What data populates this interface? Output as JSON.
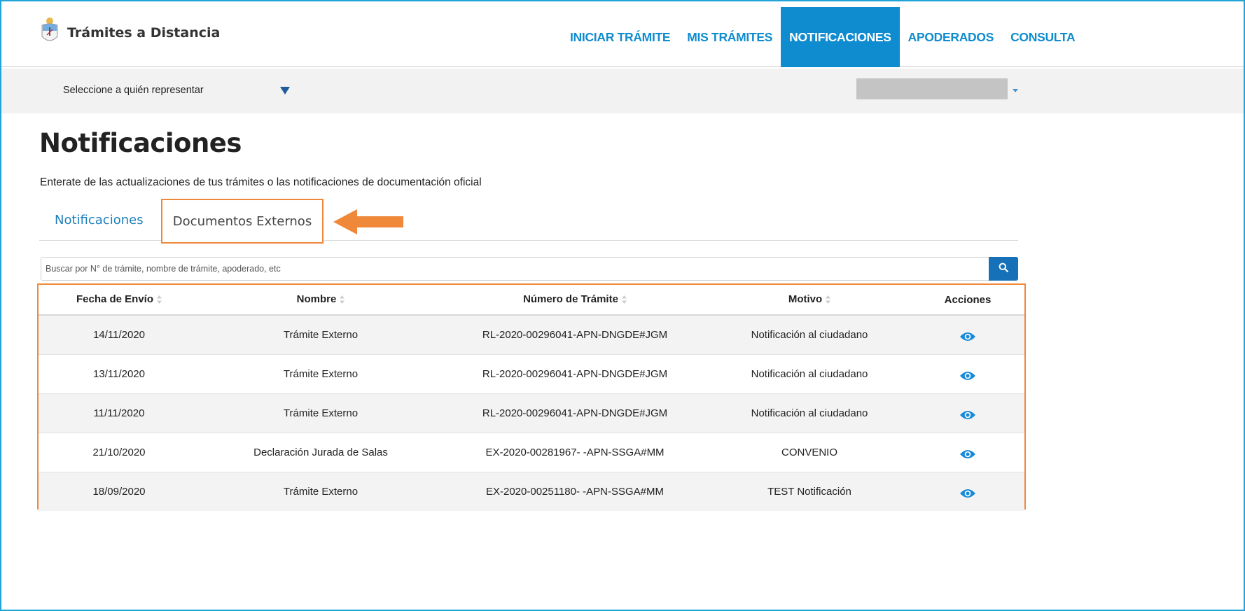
{
  "header": {
    "brand": "Trámites a Distancia",
    "nav": [
      {
        "label": "INICIAR TRÁMITE",
        "active": false
      },
      {
        "label": "MIS TRÁMITES",
        "active": false
      },
      {
        "label": "NOTIFICACIONES",
        "active": true
      },
      {
        "label": "APODERADOS",
        "active": false
      },
      {
        "label": "CONSULTA",
        "active": false
      }
    ]
  },
  "represent": {
    "label": "Seleccione a quién representar"
  },
  "main": {
    "title": "Notificaciones",
    "subtitle": "Enterate de las actualizaciones de tus trámites o las notificaciones de documentación oficial",
    "tabs": [
      {
        "label": "Notificaciones"
      },
      {
        "label": "Documentos Externos"
      }
    ],
    "search": {
      "placeholder": "Buscar por N° de trámite, nombre de trámite, apoderado, etc"
    },
    "table": {
      "columns": [
        "Fecha de Envío",
        "Nombre",
        "Número de Trámite",
        "Motivo",
        "Acciones"
      ],
      "rows": [
        {
          "fecha": "14/11/2020",
          "nombre": "Trámite Externo",
          "numero": "RL-2020-00296041-APN-DNGDE#JGM",
          "motivo": "Notificación al ciudadano"
        },
        {
          "fecha": "13/11/2020",
          "nombre": "Trámite Externo",
          "numero": "RL-2020-00296041-APN-DNGDE#JGM",
          "motivo": "Notificación al ciudadano"
        },
        {
          "fecha": "11/11/2020",
          "nombre": "Trámite Externo",
          "numero": "RL-2020-00296041-APN-DNGDE#JGM",
          "motivo": "Notificación al ciudadano"
        },
        {
          "fecha": "21/10/2020",
          "nombre": "Declaración Jurada de Salas",
          "numero": "EX-2020-00281967- -APN-SSGA#MM",
          "motivo": "CONVENIO"
        },
        {
          "fecha": "18/09/2020",
          "nombre": "Trámite Externo",
          "numero": "EX-2020-00251180- -APN-SSGA#MM",
          "motivo": "TEST Notificación"
        }
      ]
    }
  },
  "colors": {
    "primary": "#0f8ccf",
    "highlight": "#f0883a",
    "search_button": "#1671b8"
  },
  "icons": {
    "logo": "argentina-coat-of-arms-icon",
    "search": "search-icon",
    "view": "eye-icon",
    "sort": "sort-icon",
    "dropdown": "caret-down-icon",
    "pointer": "arrow-left-icon"
  }
}
